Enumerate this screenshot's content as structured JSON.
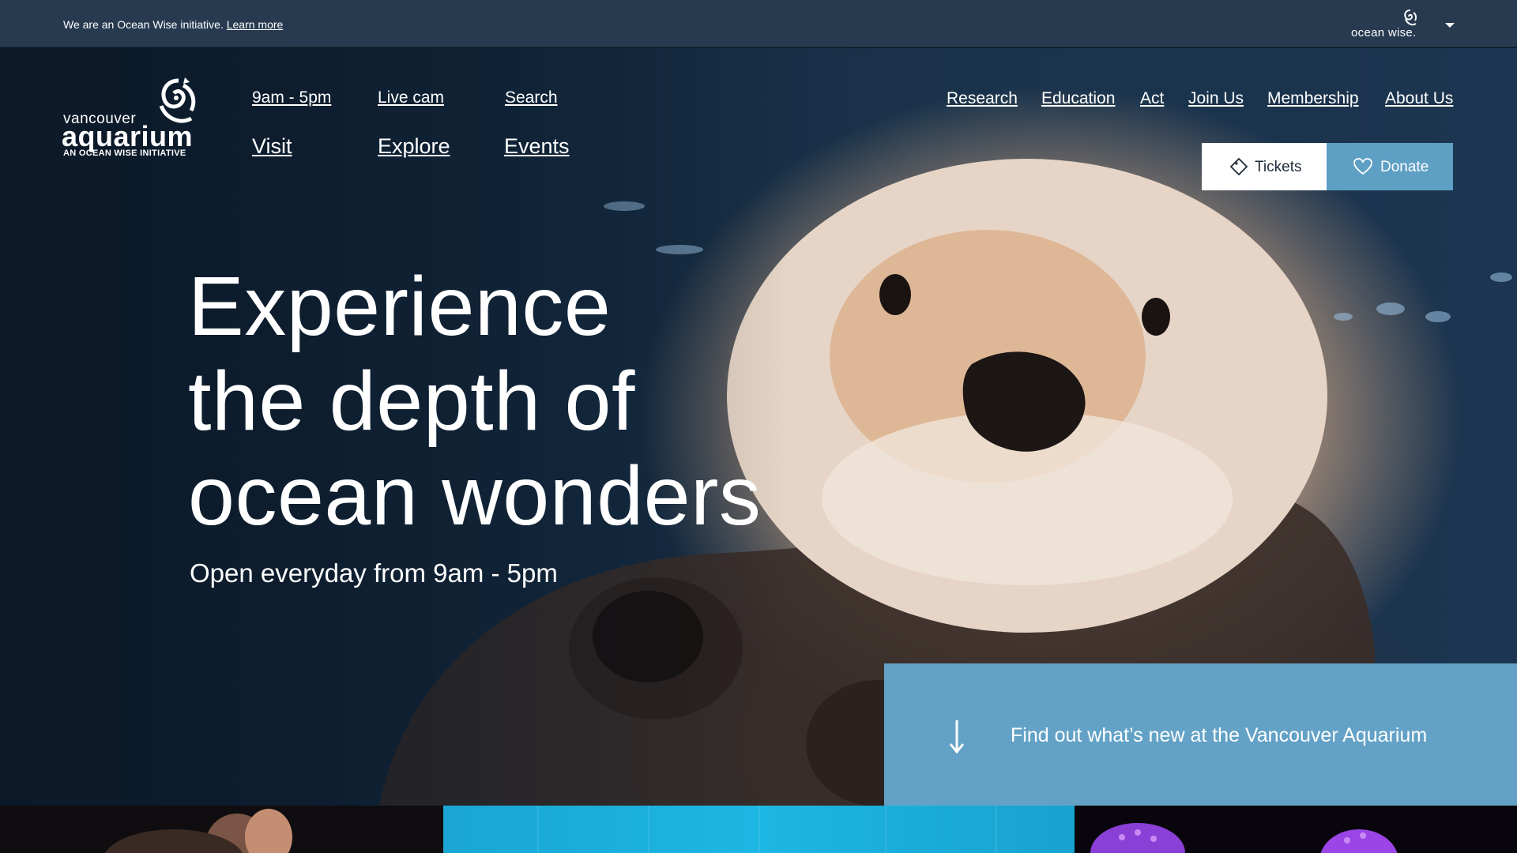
{
  "topbar": {
    "message": "We are an Ocean Wise initiative.",
    "learn_more": "Learn more",
    "partner_logo_text": "ocean wise."
  },
  "brand": {
    "line1": "vancouver",
    "line2": "aquarium",
    "tagline": "AN OCEAN WISE INITIATIVE"
  },
  "nav": {
    "hours": "9am - 5pm",
    "live_cam": "Live cam",
    "search": "Search",
    "visit": "Visit",
    "explore": "Explore",
    "events": "Events",
    "right": [
      "Research",
      "Education",
      "Act",
      "Join Us",
      "Membership",
      "About Us"
    ]
  },
  "actions": {
    "tickets": "Tickets",
    "donate": "Donate"
  },
  "hero": {
    "headline": [
      "Experience",
      "the depth of",
      "ocean wonders"
    ],
    "subline": "Open everyday from 9am - 5pm"
  },
  "news": {
    "text": "Find out what’s new at the Vancouver Aquarium"
  },
  "icons": {
    "ocean_wise": "ocean-wise-logo-icon",
    "brand": "aquarium-fish-icon",
    "tickets": "ticket-icon",
    "donate": "heart-icon",
    "news": "arrow-down-icon",
    "dropdown": "chevron-down-icon"
  },
  "colors": {
    "topbar": "#273a50",
    "donate": "#5e9fc4",
    "news_banner": "#63a2c6",
    "tickets": "#ffffff"
  }
}
